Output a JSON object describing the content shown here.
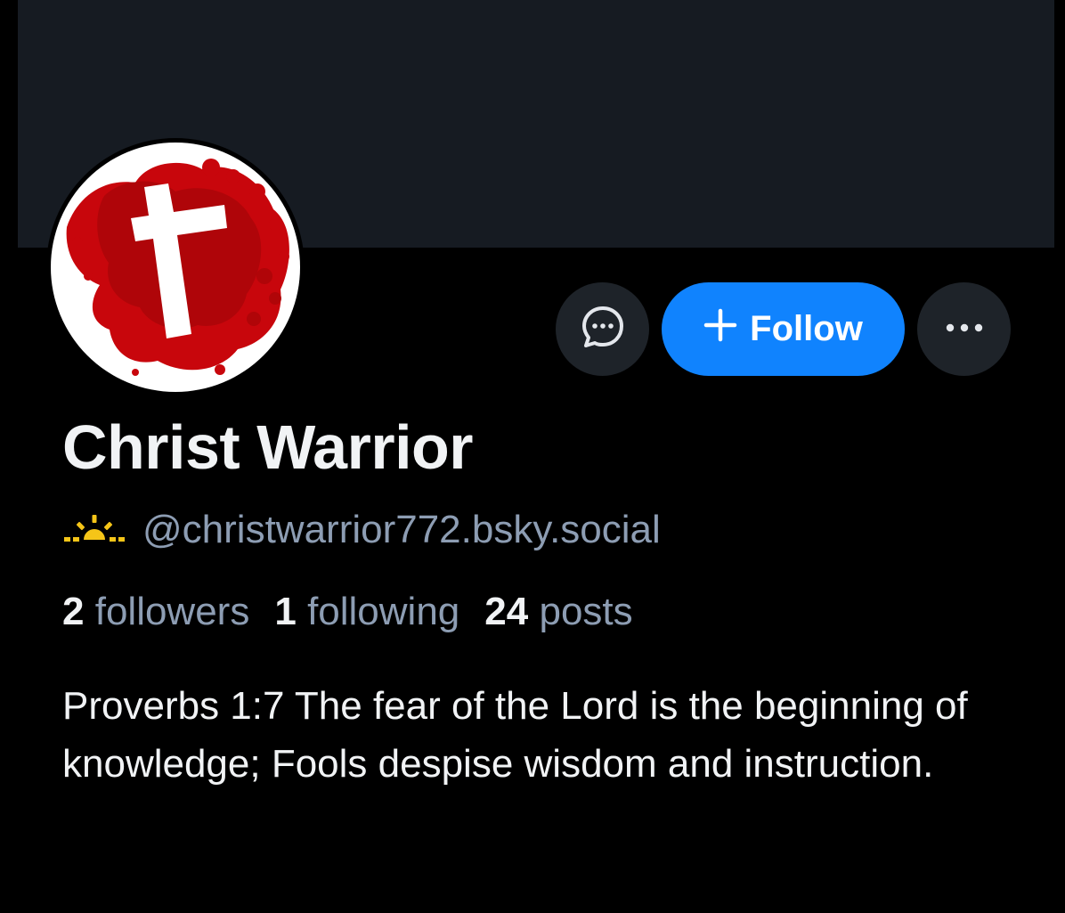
{
  "profile": {
    "display_name": "Christ Warrior",
    "handle": "@christwarrior772.bsky.social",
    "bio": "Proverbs 1:7 The fear of the Lord is the beginning of knowledge; Fools despise wisdom and instruction.",
    "handle_badge_icon": "sunrise-icon"
  },
  "stats": {
    "followers_count": "2",
    "followers_label": "followers",
    "following_count": "1",
    "following_label": "following",
    "posts_count": "24",
    "posts_label": "posts"
  },
  "actions": {
    "follow_label": "Follow",
    "message_icon": "chat-bubble-icon",
    "more_icon": "ellipsis-icon"
  },
  "colors": {
    "accent": "#1083fe",
    "background": "#000000",
    "banner": "#161b22",
    "muted_text": "#8d9db3",
    "badge": "#f5c518",
    "avatar_red": "#c8060c"
  }
}
